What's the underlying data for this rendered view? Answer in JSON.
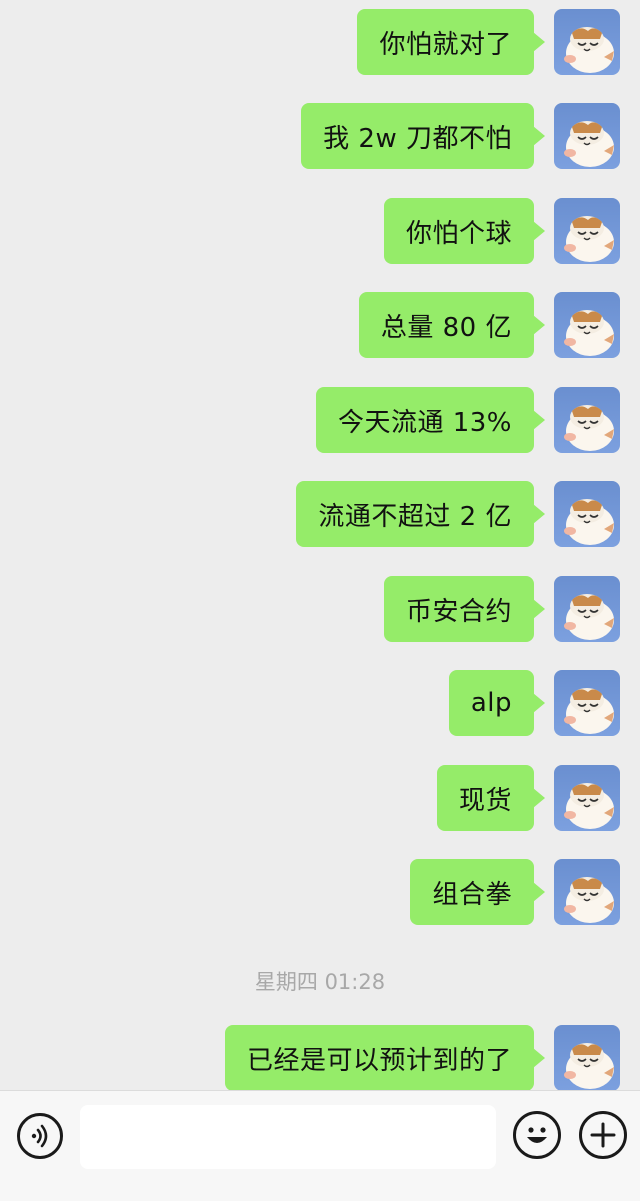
{
  "messages": [
    {
      "text": "你怕就对了"
    },
    {
      "text": "我 2w 刀都不怕"
    },
    {
      "text": "你怕个球"
    },
    {
      "text": "总量 80 亿"
    },
    {
      "text": "今天流通 13%"
    },
    {
      "text": "流通不超过 2 亿"
    },
    {
      "text": "币安合约"
    },
    {
      "text": "alp"
    },
    {
      "text": "现货"
    },
    {
      "text": "组合拳"
    },
    {
      "text": "已经是可以预计到的了"
    }
  ],
  "timestamp": "星期四 01:28",
  "input_bar": {
    "voice_icon": "voice-icon",
    "emoji_icon": "emoji-icon",
    "plus_icon": "plus-icon",
    "input_value": ""
  },
  "colors": {
    "bubble": "#95ec69",
    "background": "#ededed",
    "avatar_sky": "#7ca0df"
  }
}
